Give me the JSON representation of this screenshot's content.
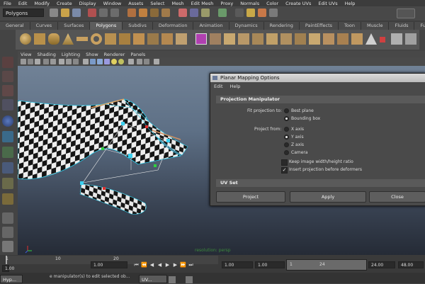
{
  "menubar": {
    "items": [
      "File",
      "Edit",
      "Modify",
      "Create",
      "Display",
      "Window",
      "Assets",
      "Select",
      "Mesh",
      "Edit Mesh",
      "Proxy",
      "Normals",
      "Color",
      "Create UVs",
      "Edit UVs",
      "Help"
    ]
  },
  "statusline": {
    "mode": "Polygons"
  },
  "shelf": {
    "tabs": [
      "General",
      "Curves",
      "Surfaces",
      "Polygons",
      "Subdivs",
      "Deformation",
      "Animation",
      "Dynamics",
      "Rendering",
      "PaintEffects",
      "Toon",
      "Muscle",
      "Fluids",
      "Fur"
    ],
    "active_tab": "Polygons"
  },
  "viewport": {
    "menu": [
      "View",
      "Shading",
      "Lighting",
      "Show",
      "Renderer",
      "Panels"
    ],
    "live_text": "resolution: persp"
  },
  "dialog": {
    "title": "Planar Mapping Options",
    "menu": [
      "Edit",
      "Help"
    ],
    "section_manipulator": "Projection Manipulator",
    "fit_label": "Fit projection to:",
    "fit_options": [
      "Best plane",
      "Bounding box"
    ],
    "fit_selected": "Bounding box",
    "project_from_label": "Project from:",
    "project_options": [
      "X axis",
      "Y axis",
      "Z axis",
      "Camera"
    ],
    "project_selected": "Y axis",
    "keep_ratio_label": "Keep image width/height ratio",
    "keep_ratio_checked": false,
    "insert_label": "Insert projection before deformers",
    "insert_checked": true,
    "section_uvset": "UV Set",
    "buttons": {
      "project": "Project",
      "apply": "Apply",
      "close": "Close"
    }
  },
  "timeslider": {
    "tick_labels": [
      "1",
      "10",
      "20"
    ],
    "start_field": "1.00",
    "current_field": "1.00",
    "range_start": "1.00",
    "range_end_inner": "1.00",
    "range_bar_start": "1",
    "range_bar_end": "24",
    "end_field": "24.00",
    "max_field": "48.00"
  },
  "helpline": "e manipulator(s) to edit selected ob...",
  "taskbar": {
    "items": [
      "Hyp...",
      "UV..."
    ]
  }
}
